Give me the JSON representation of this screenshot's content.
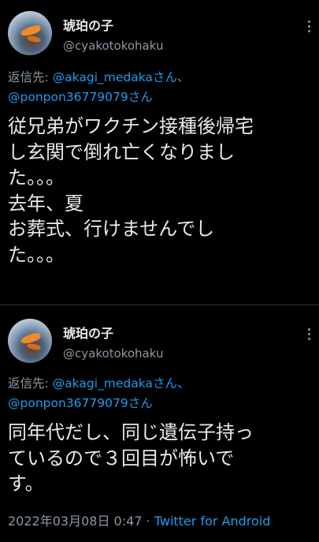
{
  "tweets": [
    {
      "name": "琥珀の子",
      "handle": "@cyakotokohaku",
      "reply_prefix": "返信先: ",
      "reply_to": [
        "@akagi_medaka",
        "@ponpon36779079"
      ],
      "reply_suffix": "さん、",
      "reply_end": "さん",
      "text": "従兄弟がワクチン接種後帰宅\nし玄関で倒れ亡くなりまし\nた。。。\n去年、夏\nお葬式、行けませんでし\nた。。。"
    },
    {
      "name": "琥珀の子",
      "handle": "@cyakotokohaku",
      "reply_prefix": "返信先: ",
      "reply_to": [
        "@akagi_medaka",
        "@ponpon36779079"
      ],
      "reply_suffix": "さん、",
      "reply_end": "さん",
      "text": "同年代だし、同じ遺伝子持っ\nているので３回目が怖いで\nす。",
      "timestamp": "2022年03月08日 0:47",
      "separator": " · ",
      "source": "Twitter for Android"
    }
  ]
}
